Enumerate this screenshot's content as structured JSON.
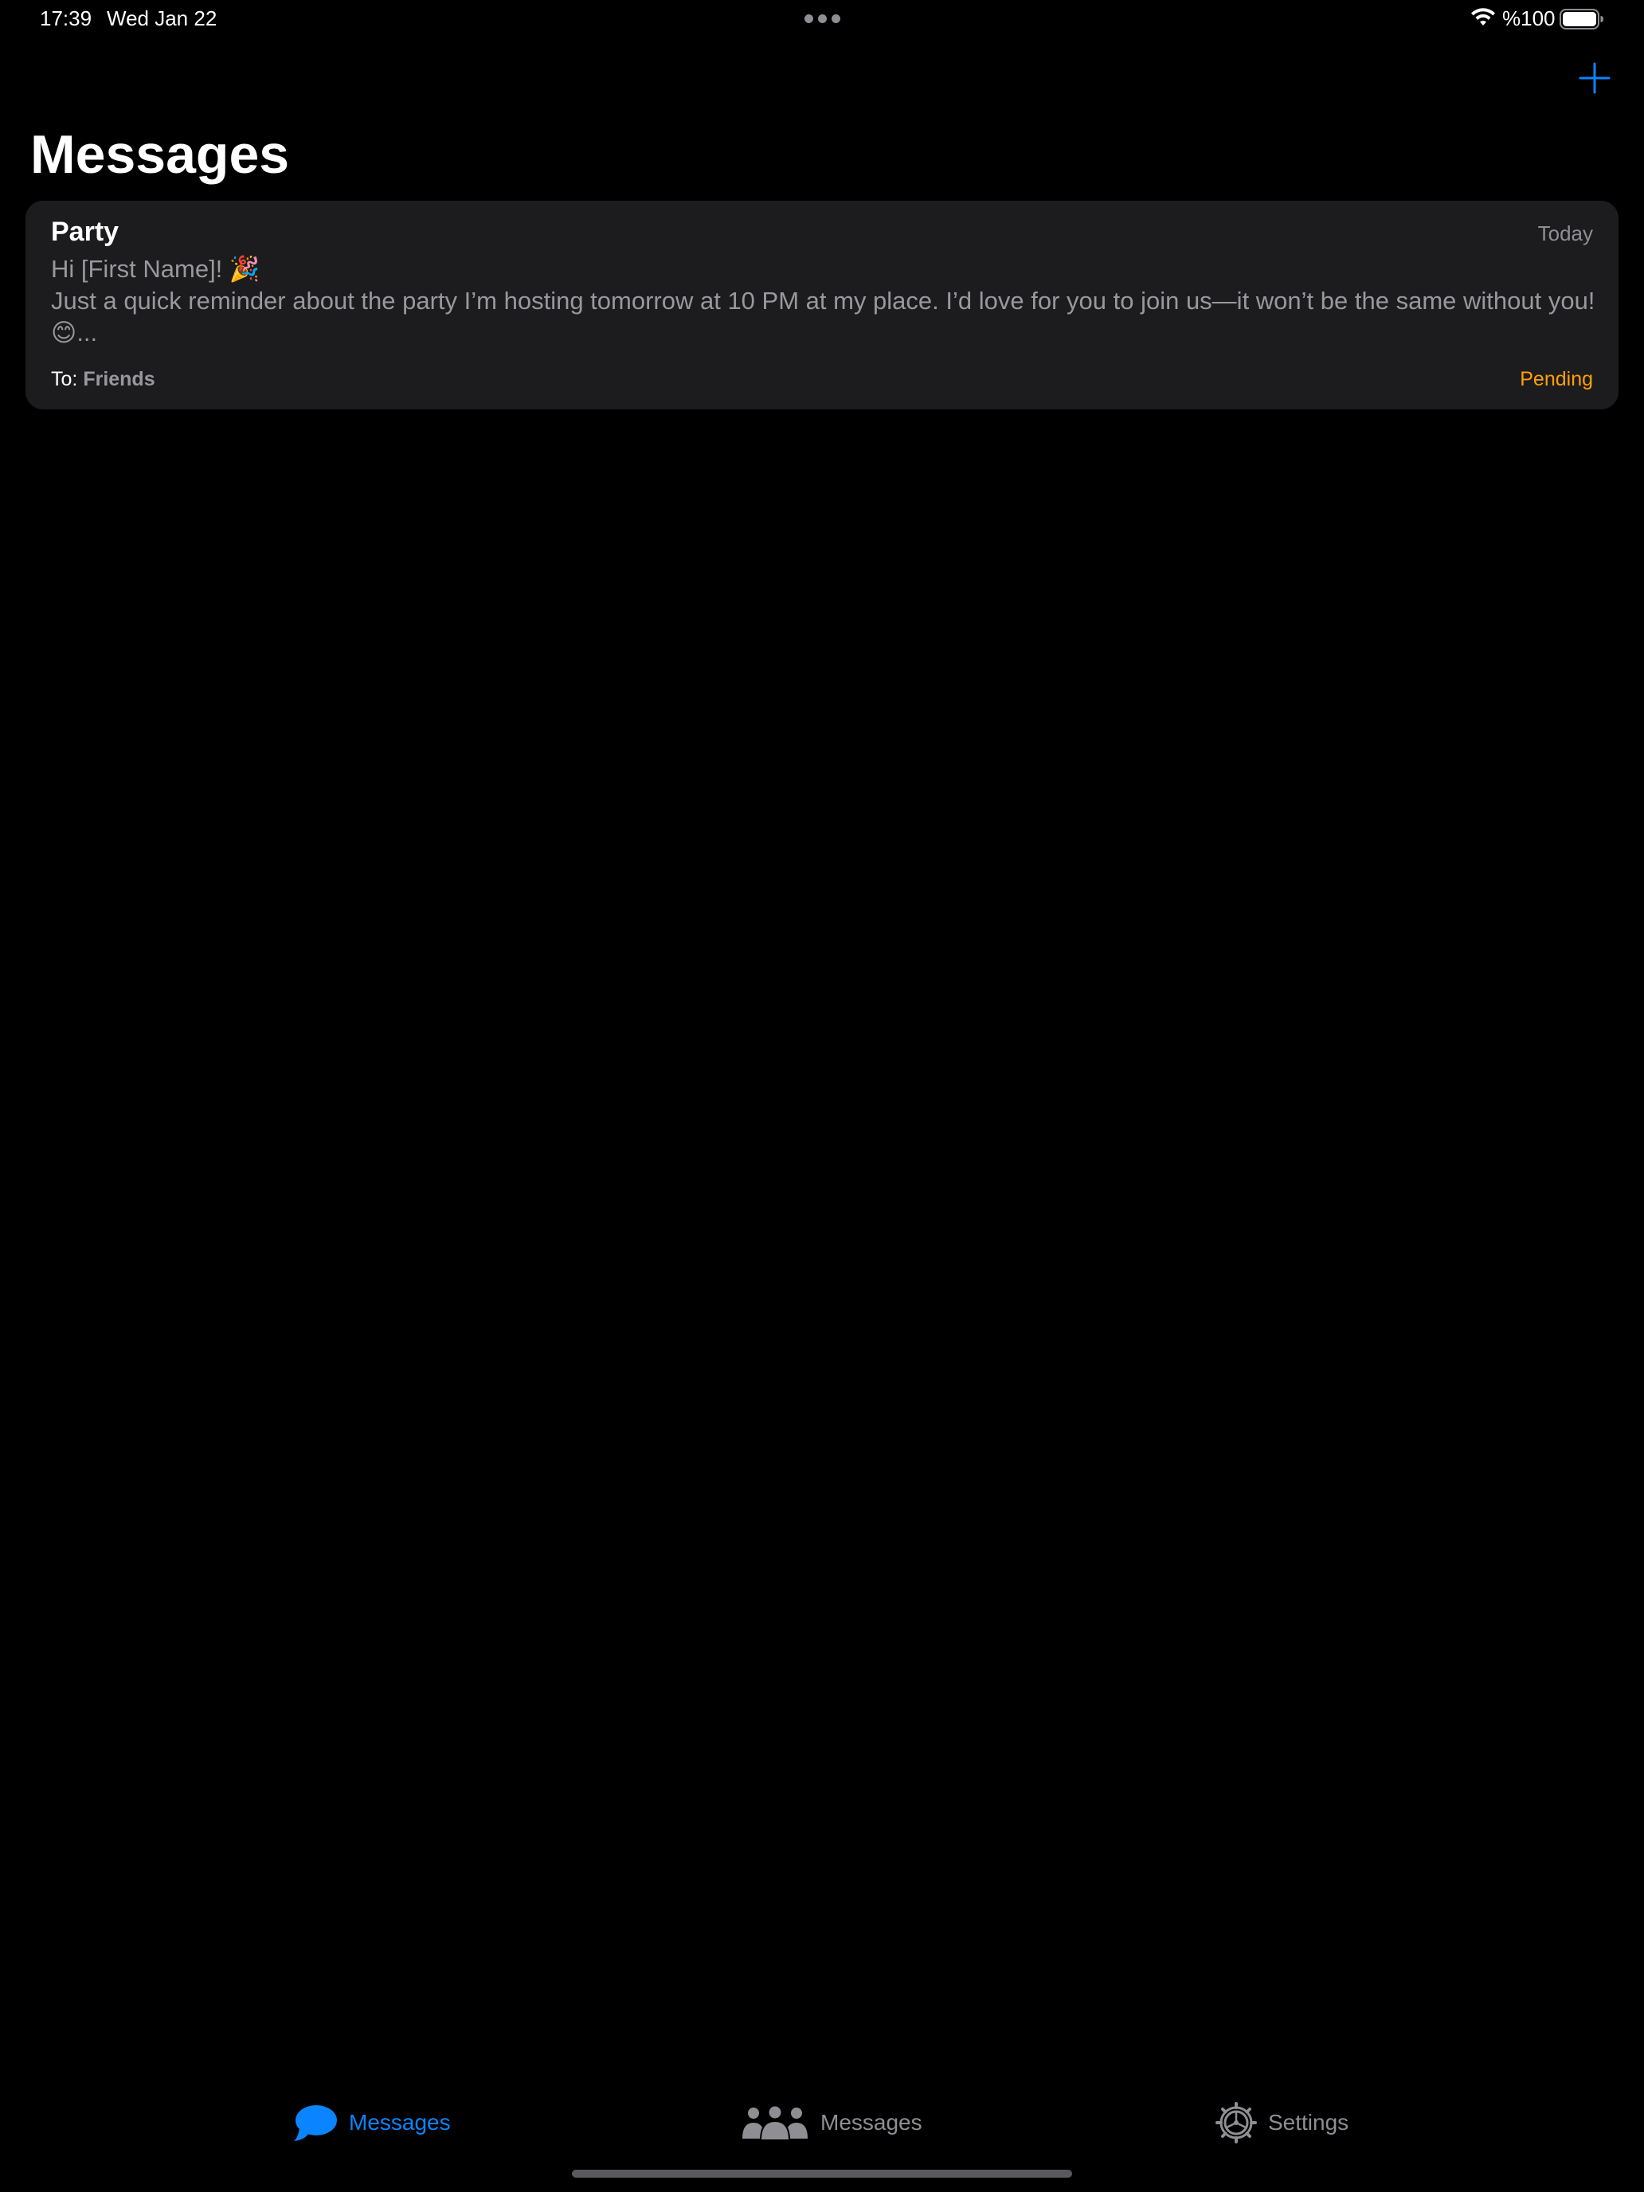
{
  "status_bar": {
    "time": "17:39",
    "date": "Wed Jan 22",
    "battery_percent": "%100"
  },
  "header": {
    "title": "Messages",
    "add_icon": "plus-icon"
  },
  "messages": [
    {
      "title": "Party",
      "date": "Today",
      "body_line1": "Hi [First Name]! 🎉",
      "body_line2": "Just a quick reminder about the party I’m hosting tomorrow at 10 PM at my place. I’d love for you to join us—it won’t be the same without you!",
      "body_line3": "😊...",
      "to_prefix": "To:",
      "to_group": "Friends",
      "status": "Pending",
      "status_color": "#ff9f0a"
    }
  ],
  "tab_bar": {
    "tabs": [
      {
        "label": "Messages",
        "icon": "message-bubble-icon",
        "active": true
      },
      {
        "label": "Messages",
        "icon": "people-group-icon",
        "active": false
      },
      {
        "label": "Settings",
        "icon": "gear-icon",
        "active": false
      }
    ]
  },
  "colors": {
    "accent": "#0a84ff",
    "background": "#000000",
    "card": "#1c1c1e",
    "secondary_text": "#8e8e93",
    "pending": "#ff9f0a"
  }
}
